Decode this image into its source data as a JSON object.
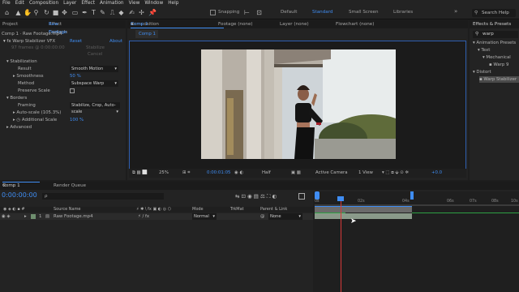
{
  "menu": [
    "File",
    "Edit",
    "Composition",
    "Layer",
    "Effect",
    "Animation",
    "View",
    "Window",
    "Help"
  ],
  "toolbar": {
    "snapping": "Snapping",
    "workspaces": [
      "Default",
      "Standard",
      "Small Screen",
      "Libraries"
    ],
    "search": "Search Help"
  },
  "project_tab": "Project",
  "effect_controls": {
    "tab": "Effect Controls",
    "tab_file": "Raw Footage",
    "breadcrumb": "Comp 1 · Raw Footage.mp4",
    "effect": "Warp Stabilizer VFX",
    "reset": "Reset",
    "about": "About",
    "frames_note": "97 frames @ 0:00:00:00",
    "stabilize_btn": "Stabilize",
    "cancel_btn": "Cancel",
    "props": [
      {
        "label": "Stabilization"
      },
      {
        "label": "Result",
        "value": "Smooth Motion"
      },
      {
        "label": "Smoothness",
        "value": "50 %"
      },
      {
        "label": "Method",
        "value": "Subspace Warp"
      },
      {
        "label": "Preserve Scale"
      },
      {
        "label": "Borders"
      },
      {
        "label": "Framing",
        "value": "Stabilize, Crop, Auto-scale"
      },
      {
        "label": "Auto-scale (105.3%)"
      },
      {
        "label": "Additional Scale",
        "value": "100 %"
      },
      {
        "label": "Advanced"
      }
    ]
  },
  "composition": {
    "tab": "Composition",
    "tab_name": "Comp 1",
    "footage_tab": "Footage (none)",
    "layer_tab": "Layer (none)",
    "flowchart_tab": "Flowchart (none)",
    "subtab": "Comp 1",
    "zoom": "25%",
    "timecode": "0:00:01:05",
    "resolution": "Half",
    "camera": "Active Camera",
    "views": "1 View",
    "exposure": "+0.0"
  },
  "effects_presets": {
    "tab": "Effects & Presets",
    "search": "warp",
    "tree": [
      "Animation Presets",
      "Text",
      "Mechanical",
      "Warp 9",
      "Distort",
      "Warp Stabilizer"
    ]
  },
  "timeline": {
    "tab": "Comp 1",
    "render_queue": "Render Queue",
    "timecode": "0:00:00:00",
    "search_placeholder": "ρ",
    "columns": {
      "source": "Source Name",
      "mode": "Mode",
      "trkmat": "TrkMat",
      "parent": "Parent & Link"
    },
    "layer": {
      "number": "1",
      "name": "Raw Footage.mp4",
      "mode": "Normal",
      "parent": "None"
    },
    "ticks": [
      "0s",
      "02s",
      "04s",
      "06s",
      "07s",
      "08s",
      "10s"
    ]
  },
  "colors": {
    "accent": "#3f8df3",
    "bg": "#1d1d1d",
    "panel": "#232323",
    "green": "#2ea043"
  }
}
